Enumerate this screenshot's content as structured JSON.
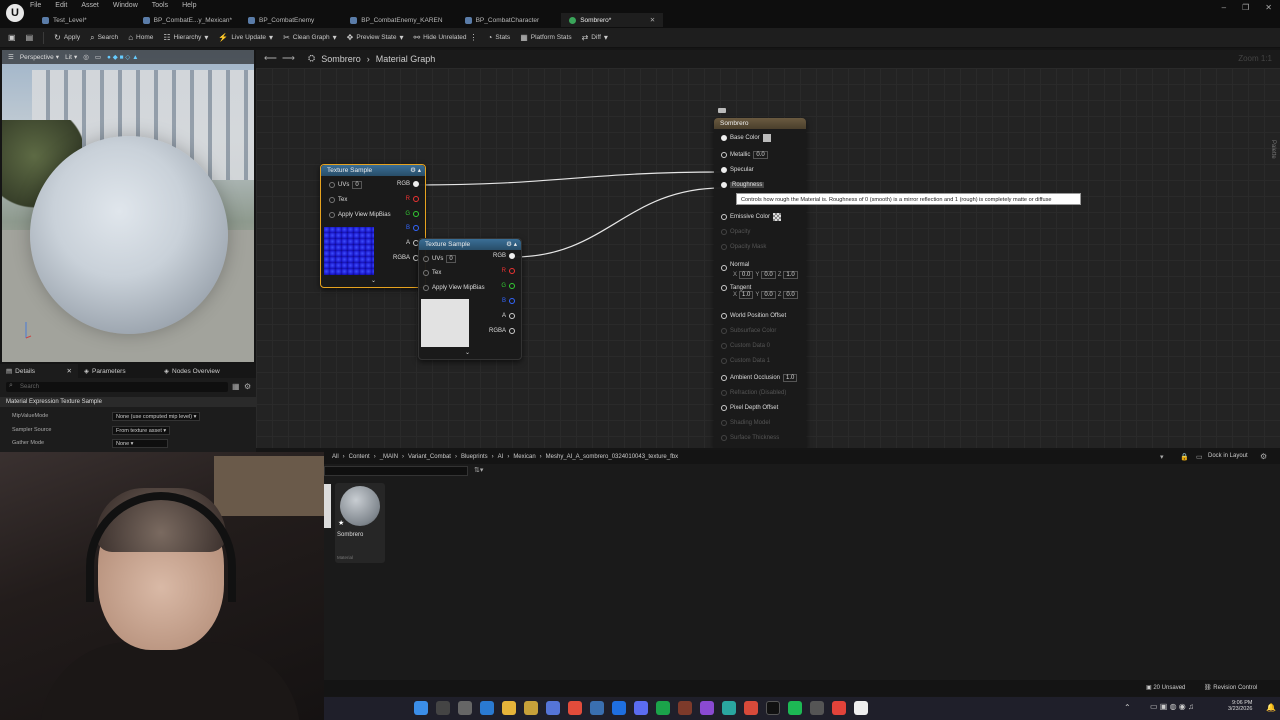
{
  "menu": [
    "File",
    "Edit",
    "Asset",
    "Window",
    "Tools",
    "Help"
  ],
  "tabs": [
    {
      "label": "Test_Level*"
    },
    {
      "label": "BP_CombatE...y_Mexican*"
    },
    {
      "label": "BP_CombatEnemy"
    },
    {
      "label": "BP_CombatEnemy_KAREN"
    },
    {
      "label": "BP_CombatCharacter"
    },
    {
      "label": "Sombrero*",
      "active": true
    }
  ],
  "toolbar": {
    "apply": "Apply",
    "search": "Search",
    "home": "Home",
    "hierarchy": "Hierarchy",
    "live_update": "Live Update",
    "clean_graph": "Clean Graph",
    "preview_state": "Preview State",
    "hide_unrelated": "Hide Unrelated",
    "stats": "Stats",
    "platform_stats": "Platform Stats",
    "diff": "Diff"
  },
  "viewport": {
    "mode": "Perspective",
    "lit": "Lit"
  },
  "details": {
    "tabs": [
      "Details",
      "Parameters",
      "Nodes Overview"
    ],
    "search_placeholder": "Search",
    "section": "Material Expression Texture Sample",
    "props": [
      {
        "label": "MipValueMode",
        "value": "None (use computed mip level)"
      },
      {
        "label": "Sampler Source",
        "value": "From texture asset"
      },
      {
        "label": "Gather Mode",
        "value": "None"
      }
    ]
  },
  "graph": {
    "breadcrumb_root": "Sombrero",
    "breadcrumb_leaf": "Material Graph",
    "zoom": "Zoom 1:1",
    "palette": "Palette"
  },
  "node1": {
    "title": "Texture Sample",
    "uvs": "UVs",
    "uvs_val": "0",
    "tex": "Tex",
    "mip": "Apply View MipBias",
    "rgb": "RGB",
    "r": "R",
    "g": "G",
    "b": "B",
    "a": "A",
    "rgba": "RGBA"
  },
  "node2": {
    "title": "Texture Sample",
    "uvs": "UVs",
    "uvs_val": "0",
    "tex": "Tex",
    "mip": "Apply View MipBias",
    "rgb": "RGB",
    "r": "R",
    "g": "G",
    "b": "B",
    "a": "A",
    "rgba": "RGBA"
  },
  "result": {
    "title": "Sombrero",
    "base": "Base Color",
    "metallic": "Metallic",
    "metallic_val": "0.0",
    "specular": "Specular",
    "roughness": "Roughness",
    "emissive": "Emissive Color",
    "opacity": "Opacity",
    "opacity_mask": "Opacity Mask",
    "normal": "Normal",
    "normal_vals": [
      "0.0",
      "0.0",
      "1.0"
    ],
    "tangent": "Tangent",
    "tangent_vals": [
      "1.0",
      "0.0",
      "0.0"
    ],
    "wpo": "World Position Offset",
    "subsurface": "Subsurface Color",
    "cd0": "Custom Data 0",
    "cd1": "Custom Data 1",
    "ao": "Ambient Occlusion",
    "ao_val": "1.0",
    "refraction": "Refraction (Disabled)",
    "pdo": "Pixel Depth Offset",
    "shading": "Shading Model",
    "thickness": "Surface Thickness"
  },
  "tooltip": "Controls how rough the Material is. Roughness of 0 (smooth) is a mirror reflection and 1 (rough) is completely matte or diffuse",
  "content_browser": {
    "path": [
      "All",
      "Content",
      "_MAIN",
      "Variant_Combat",
      "Blueprints",
      "AI",
      "Mexican",
      "Meshy_AI_A_sombrero_0324010043_texture_fbx"
    ],
    "dock": "Dock in Layout",
    "asset_name": "Sombrero",
    "asset_type": "Material"
  },
  "status": {
    "unsaved": "20 Unsaved",
    "revision": "Revision Control"
  },
  "clock": {
    "time": "9:06 PM",
    "date": "3/23/2026"
  }
}
